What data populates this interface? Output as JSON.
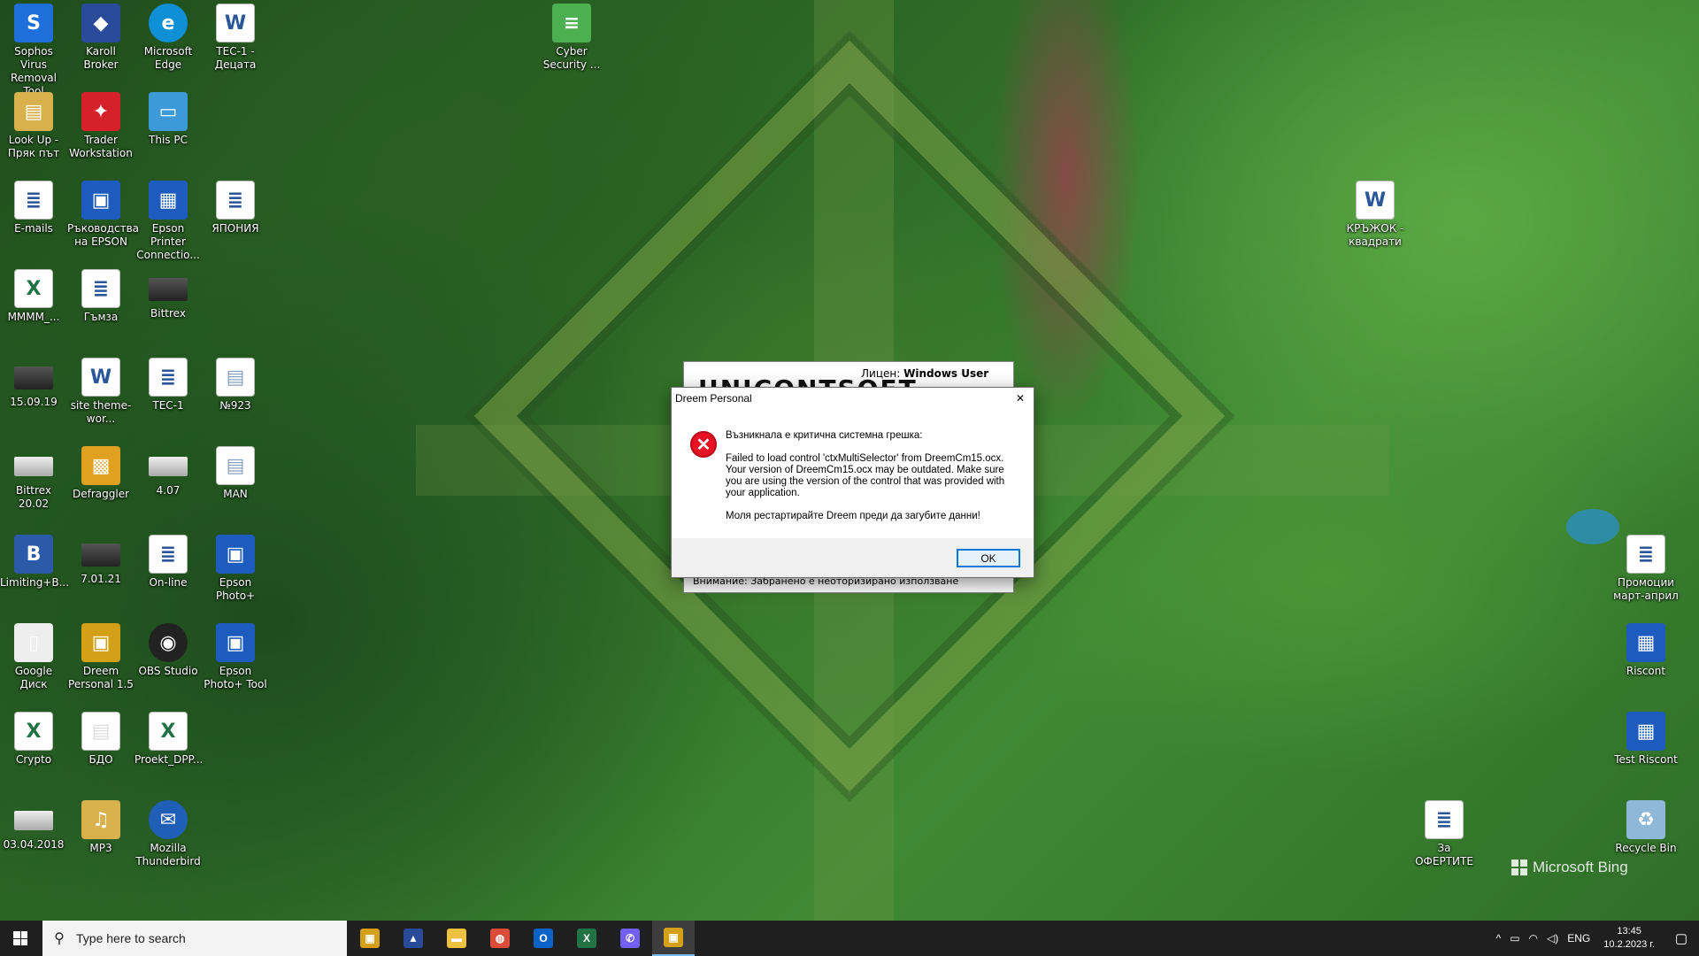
{
  "desktop": {
    "icons": [
      {
        "label": "Sophos Virus Removal Tool",
        "icon": "sophos-icon",
        "color": "#1e6fd9",
        "glyph": "S"
      },
      {
        "label": "Karoll Broker",
        "icon": "karoll-broker-icon",
        "color": "#2a4a9a",
        "glyph": "◆"
      },
      {
        "label": "Microsoft Edge",
        "icon": "edge-icon",
        "color": "#0f8fd6",
        "glyph": "e"
      },
      {
        "label": "ТЕС-1 - Децата",
        "icon": "word-doc-icon",
        "color": "#2b579a",
        "glyph": "W"
      },
      {
        "label": "Cyber Security ...",
        "icon": "shortcut-doc-icon",
        "color": "#4caf50",
        "glyph": "≡"
      },
      {
        "label": "Look Up - Пряк път",
        "icon": "folder-doc-icon",
        "color": "#d8b04c",
        "glyph": "▤"
      },
      {
        "label": "Trader Workstation",
        "icon": "trader-workstation-icon",
        "color": "#d6202a",
        "glyph": "✦"
      },
      {
        "label": "This PC",
        "icon": "this-pc-icon",
        "color": "#3c9ad8",
        "glyph": "▭"
      },
      {
        "label": "E-mails",
        "icon": "word-doc-icon",
        "color": "#2b579a",
        "glyph": "≣"
      },
      {
        "label": "Ръководства на EPSON",
        "icon": "epson-manual-icon",
        "color": "#1d5bbf",
        "glyph": "▣"
      },
      {
        "label": "Epson Printer Connectio...",
        "icon": "epson-printer-icon",
        "color": "#1d5bbf",
        "glyph": "▦"
      },
      {
        "label": "ЯПОНИЯ",
        "icon": "word-doc-icon",
        "color": "#2b579a",
        "glyph": "≣"
      },
      {
        "label": "КРЪЖОК - квадрати",
        "icon": "word-doc-icon",
        "color": "#2b579a",
        "glyph": "W"
      },
      {
        "label": "MMMM_...",
        "icon": "excel-doc-icon",
        "color": "#217346",
        "glyph": "X"
      },
      {
        "label": "Гъмза",
        "icon": "word-doc-icon",
        "color": "#2b579a",
        "glyph": "≣"
      },
      {
        "label": "Bittrex",
        "icon": "drive-icon",
        "color": "#333333",
        "glyph": ""
      },
      {
        "label": "15.09.19",
        "icon": "drive-icon",
        "color": "#333333",
        "glyph": ""
      },
      {
        "label": "site theme-wor...",
        "icon": "word-doc-icon",
        "color": "#2b579a",
        "glyph": "W"
      },
      {
        "label": "ТЕС-1",
        "icon": "word-doc-icon",
        "color": "#2b579a",
        "glyph": "≣"
      },
      {
        "label": "№923",
        "icon": "image-doc-icon",
        "color": "#8aa0c0",
        "glyph": "▤"
      },
      {
        "label": "Bittrex 20.02",
        "icon": "drive-light-icon",
        "color": "#cccccc",
        "glyph": ""
      },
      {
        "label": "Defraggler",
        "icon": "defraggler-icon",
        "color": "#e0a020",
        "glyph": "▩"
      },
      {
        "label": "4.07",
        "icon": "drive-light-icon",
        "color": "#cccccc",
        "glyph": ""
      },
      {
        "label": "MAN",
        "icon": "image-doc-icon",
        "color": "#8aa0c0",
        "glyph": "▤"
      },
      {
        "label": "Limiting+B...",
        "icon": "book-cover-icon",
        "color": "#2a5aa8",
        "glyph": "B"
      },
      {
        "label": "7.01.21",
        "icon": "drive-icon",
        "color": "#333333",
        "glyph": ""
      },
      {
        "label": "On-line",
        "icon": "word-doc-icon",
        "color": "#2b579a",
        "glyph": "≣"
      },
      {
        "label": "Epson Photo+",
        "icon": "epson-photo-icon",
        "color": "#1d5bbf",
        "glyph": "▣"
      },
      {
        "label": "Промоции март-април",
        "icon": "word-doc-icon",
        "color": "#2b579a",
        "glyph": "≣"
      },
      {
        "label": "Google Диск",
        "icon": "google-drive-icon",
        "color": "#eeeeee",
        "glyph": "▯"
      },
      {
        "label": "Dreem Personal 1.5",
        "icon": "dreem-icon",
        "color": "#d4a017",
        "glyph": "▣"
      },
      {
        "label": "OBS Studio",
        "icon": "obs-icon",
        "color": "#222222",
        "glyph": "◉"
      },
      {
        "label": "Epson Photo+ Tool",
        "icon": "epson-photo-tool-icon",
        "color": "#1d5bbf",
        "glyph": "▣"
      },
      {
        "label": "Riscont",
        "icon": "riscont-icon",
        "color": "#1d5bbf",
        "glyph": "▦"
      },
      {
        "label": "Crypto",
        "icon": "excel-doc-icon",
        "color": "#217346",
        "glyph": "X"
      },
      {
        "label": "БДО",
        "icon": "image-doc-icon",
        "color": "#dddddd",
        "glyph": "▤"
      },
      {
        "label": "Proekt_DPP...",
        "icon": "excel-doc-icon",
        "color": "#217346",
        "glyph": "X"
      },
      {
        "label": "Test Riscont",
        "icon": "riscont-icon",
        "color": "#1d5bbf",
        "glyph": "▦"
      },
      {
        "label": "03.04.2018",
        "icon": "drive-light-icon",
        "color": "#cccccc",
        "glyph": ""
      },
      {
        "label": "MP3",
        "icon": "mp3-folder-icon",
        "color": "#d8b04c",
        "glyph": "♫"
      },
      {
        "label": "Mozilla Thunderbird",
        "icon": "thunderbird-icon",
        "color": "#1f5fb8",
        "glyph": "✉"
      },
      {
        "label": "За ОФЕРТИТЕ",
        "icon": "word-doc-icon",
        "color": "#2b579a",
        "glyph": "≣"
      },
      {
        "label": "Recycle Bin",
        "icon": "recycle-bin-icon",
        "color": "#8fb8d8",
        "glyph": "♻"
      }
    ]
  },
  "background_window": {
    "license_label": "Лицен:",
    "license_user": "Windows User",
    "brand_text": "UNICONTSOFT",
    "warning": "Внимание: Забранено е неоторизирано използване"
  },
  "dialog": {
    "title": "Dreem Personal",
    "heading": "Възникнала е критична системна грешка:",
    "message": "Failed to load control 'ctxMultiSelector' from DreemCm15.ocx. Your version of DreemCm15.ocx may be outdated. Make sure you are using the version of the control that was provided with your application.",
    "restart_note": "Моля рестартирайте Dreem преди да загубите данни!",
    "ok_label": "OK",
    "error_icon": "error-x-icon",
    "close_glyph": "✕"
  },
  "watermark": {
    "text": "Microsoft Bing"
  },
  "taskbar": {
    "search_placeholder": "Type here to search",
    "apps": [
      {
        "name": "dreem-app",
        "color": "#d4a017",
        "glyph": "▣"
      },
      {
        "name": "ibkr-app",
        "color": "#2a4a9a",
        "glyph": "▲"
      },
      {
        "name": "file-explorer-app",
        "color": "#f0c040",
        "glyph": "▬"
      },
      {
        "name": "chrome-app",
        "color": "#dd4b39",
        "glyph": "◍"
      },
      {
        "name": "outlook-app",
        "color": "#0a64c8",
        "glyph": "O"
      },
      {
        "name": "excel-app",
        "color": "#217346",
        "glyph": "X"
      },
      {
        "name": "viber-app",
        "color": "#7360f2",
        "glyph": "✆"
      },
      {
        "name": "dreem-active-app",
        "color": "#d4a017",
        "glyph": "▣"
      }
    ],
    "tray": {
      "chevron": "^",
      "language": "ENG",
      "time": "13:45",
      "date": "10.2.2023 г."
    }
  }
}
